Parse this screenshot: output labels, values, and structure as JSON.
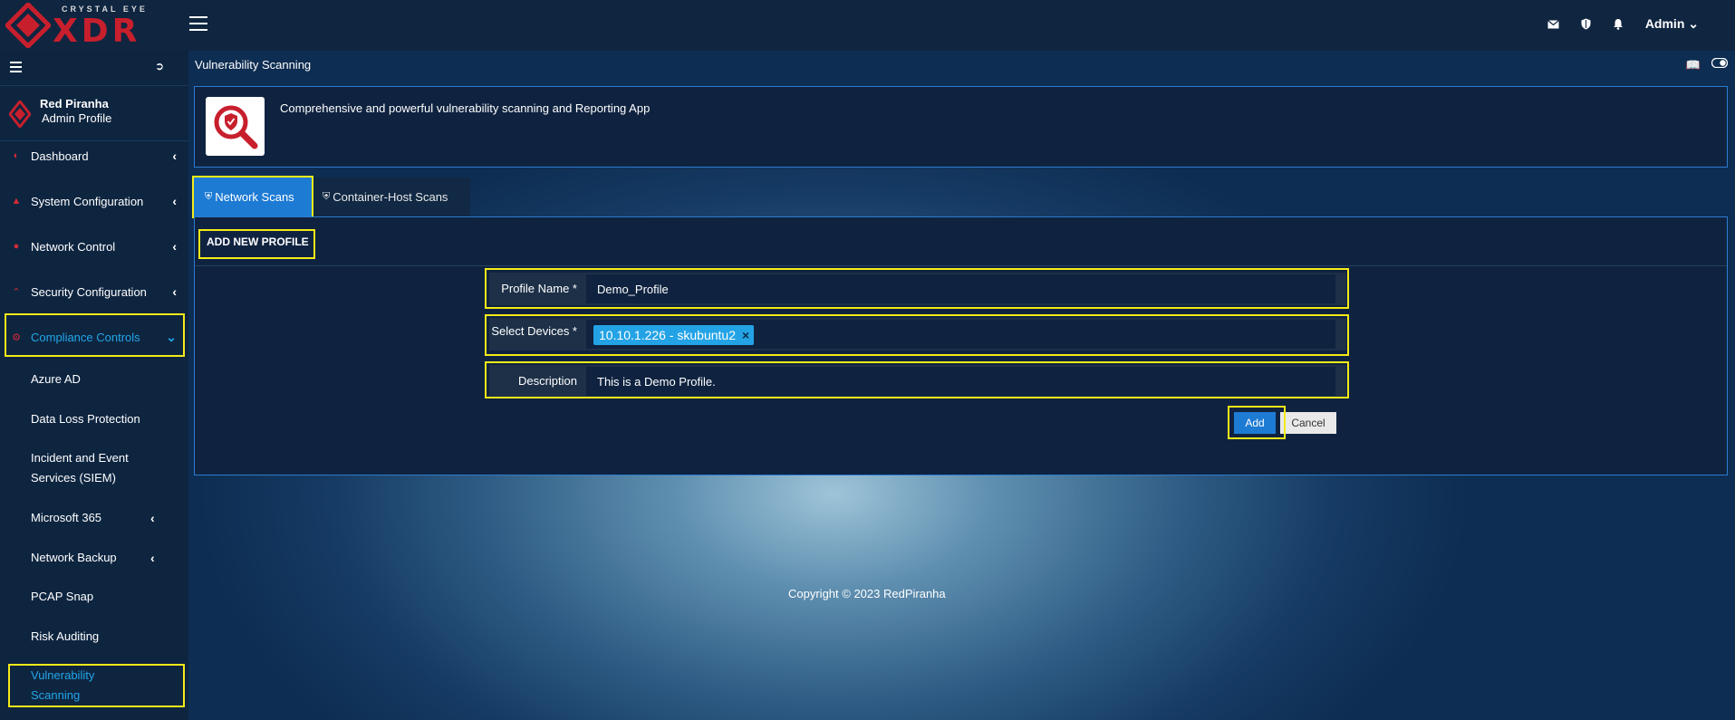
{
  "brand": {
    "top": "CRYSTAL EYE",
    "main": "XDR"
  },
  "topbar": {
    "user": "Admin",
    "icons": [
      "envelope-icon",
      "shield-icon",
      "bell-icon"
    ]
  },
  "sidebar": {
    "profile": {
      "name": "Red Piranha",
      "role": "Admin Profile"
    },
    "items": [
      {
        "label": "Dashboard"
      },
      {
        "label": "System Configuration"
      },
      {
        "label": "Network Control"
      },
      {
        "label": "Security Configuration"
      },
      {
        "label": "Compliance Controls"
      }
    ],
    "sub_items": [
      {
        "label": "Azure AD"
      },
      {
        "label": "Data Loss Protection"
      },
      {
        "label": "Incident and Event"
      },
      {
        "label": "Services (SIEM)"
      },
      {
        "label": "Microsoft 365"
      },
      {
        "label": "Network Backup"
      },
      {
        "label": "PCAP Snap"
      },
      {
        "label": "Risk Auditing"
      },
      {
        "label": "Vulnerability"
      },
      {
        "label": "Scanning"
      }
    ]
  },
  "page": {
    "title": "Vulnerability Scanning",
    "app_description": "Comprehensive and powerful vulnerability scanning and Reporting App"
  },
  "tabs": [
    {
      "label": "Network Scans"
    },
    {
      "label": "Container-Host Scans"
    }
  ],
  "form": {
    "add_new_label": "ADD NEW PROFILE",
    "profile_name_label": "Profile Name *",
    "profile_name_value": "Demo_Profile",
    "devices_label": "Select Devices *",
    "device_tag": "10.10.1.226 - skubuntu2",
    "description_label": "Description",
    "description_value": "This is a Demo Profile.",
    "add_label": "Add",
    "cancel_label": "Cancel"
  },
  "footer": {
    "copyright": "Copyright © 2023 RedPiranha"
  },
  "colors": {
    "accent": "#1e7bd4",
    "highlight": "#f5ea18",
    "brand_red": "#c81f2d",
    "active_link": "#23a6e8"
  }
}
